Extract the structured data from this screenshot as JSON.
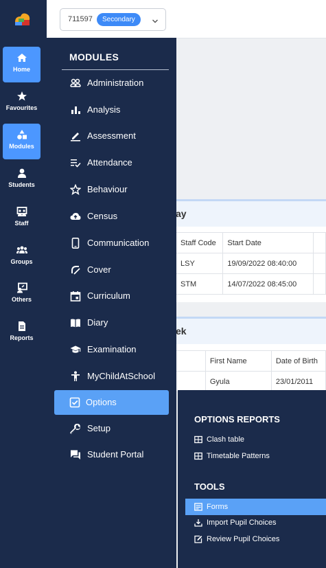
{
  "rail": {
    "items": [
      {
        "label": "Home",
        "icon": "home-icon",
        "active": true
      },
      {
        "label": "Favourites",
        "icon": "star-icon",
        "active": false
      },
      {
        "label": "Modules",
        "icon": "shapes-icon",
        "active": true
      },
      {
        "label": "Students",
        "icon": "person-icon",
        "active": false
      },
      {
        "label": "Staff",
        "icon": "staff-board-icon",
        "active": false
      },
      {
        "label": "Groups",
        "icon": "groups-icon",
        "active": false
      },
      {
        "label": "Others",
        "icon": "others-icon",
        "active": false
      },
      {
        "label": "Reports",
        "icon": "document-icon",
        "active": false
      }
    ]
  },
  "header": {
    "school_id": "711597",
    "school_type": "Secondary"
  },
  "background": {
    "card1": {
      "title_fragment": "ay",
      "columns": [
        "Staff Code",
        "Start Date"
      ],
      "rows": [
        [
          "LSY",
          "19/09/2022 08:40:00"
        ],
        [
          "STM",
          "14/07/2022 08:45:00"
        ]
      ]
    },
    "card2": {
      "title_fragment": "ek",
      "columns": [
        "First Name",
        "Date of Birth"
      ],
      "rows": [
        [
          "Gyula",
          "23/01/2011"
        ]
      ]
    }
  },
  "modules": {
    "title": "MODULES",
    "items": [
      {
        "label": "Administration",
        "icon": "admin-people-icon"
      },
      {
        "label": "Analysis",
        "icon": "bar-chart-icon"
      },
      {
        "label": "Assessment",
        "icon": "pencil-icon"
      },
      {
        "label": "Attendance",
        "icon": "list-check-icon"
      },
      {
        "label": "Behaviour",
        "icon": "star-outline-icon"
      },
      {
        "label": "Census",
        "icon": "cloud-upload-icon"
      },
      {
        "label": "Communication",
        "icon": "phone-icon"
      },
      {
        "label": "Cover",
        "icon": "cover-icon"
      },
      {
        "label": "Curriculum",
        "icon": "calendar-icon"
      },
      {
        "label": "Diary",
        "icon": "book-icon"
      },
      {
        "label": "Examination",
        "icon": "graduation-cap-icon"
      },
      {
        "label": "MyChildAtSchool",
        "icon": "child-icon"
      },
      {
        "label": "Options",
        "icon": "checkbox-icon",
        "active": true
      },
      {
        "label": "Setup",
        "icon": "wrench-icon"
      },
      {
        "label": "Student Portal",
        "icon": "chat-icon"
      }
    ]
  },
  "options_flyout": {
    "reports_heading": "OPTIONS REPORTS",
    "reports": [
      {
        "label": "Clash table",
        "icon": "table-icon"
      },
      {
        "label": "Timetable Patterns",
        "icon": "table-icon"
      }
    ],
    "tools_heading": "TOOLS",
    "tools": [
      {
        "label": "Forms",
        "icon": "form-icon",
        "active": true
      },
      {
        "label": "Import Pupil Choices",
        "icon": "download-icon"
      },
      {
        "label": "Review Pupil Choices",
        "icon": "edit-icon"
      }
    ]
  },
  "colors": {
    "sidebar_bg": "#1b2b4b",
    "active_blue": "#5aa1f6",
    "badge_blue": "#3d8af7"
  }
}
